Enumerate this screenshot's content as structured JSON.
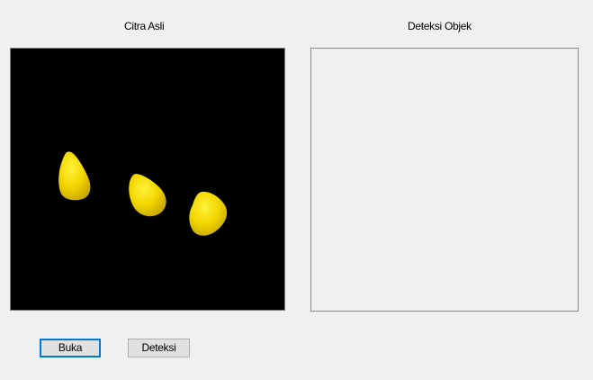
{
  "panels": {
    "original": {
      "title": "Citra Asli",
      "image_content": "three yellow corn kernels on black background"
    },
    "detection": {
      "title": "Deteksi Objek"
    }
  },
  "buttons": {
    "open_label": "Buka",
    "detect_label": "Deteksi"
  },
  "colors": {
    "window_bg": "#f0f0f0",
    "image_bg": "#000000",
    "kernel": "#f2d600",
    "button_focus": "#0078d7"
  }
}
